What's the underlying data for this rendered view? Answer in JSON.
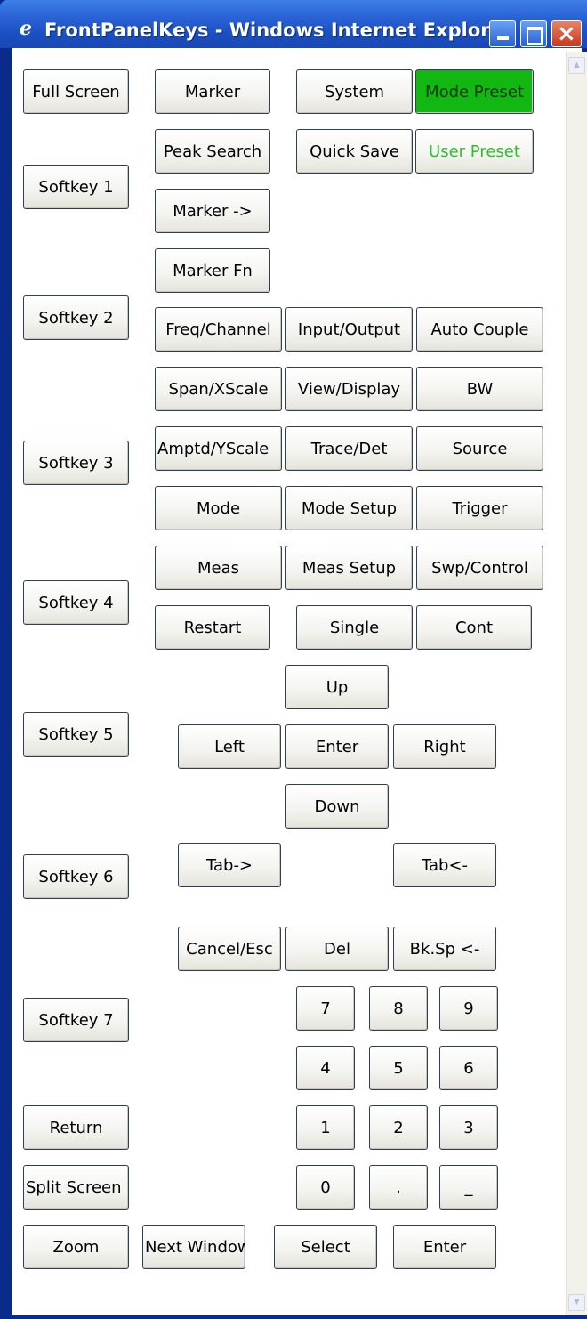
{
  "window": {
    "title": "FrontPanelKeys - Windows Internet Explorer",
    "ie_logo": "e",
    "controls": {
      "minimize": "minimize",
      "maximize": "maximize",
      "close": "×"
    },
    "title_bar_color": "#2a63d6"
  },
  "keys": {
    "full_screen": "Full Screen",
    "marker": "Marker",
    "system": "System",
    "mode_preset": "Mode Preset",
    "peak_search": "Peak Search",
    "quick_save": "Quick Save",
    "user_preset": "User Preset",
    "softkey_1": "Softkey 1",
    "marker_to": "Marker ->",
    "marker_fn": "Marker Fn",
    "softkey_2": "Softkey 2",
    "freq_channel": "Freq/Channel",
    "input_output": "Input/Output",
    "auto_couple": "Auto Couple",
    "span_xscale": "Span/XScale",
    "view_display": "View/Display",
    "bw": "BW",
    "softkey_3": "Softkey 3",
    "amptd_yscale": "Amptd/YScale",
    "trace_det": "Trace/Det",
    "source": "Source",
    "mode": "Mode",
    "mode_setup": "Mode Setup",
    "trigger": "Trigger",
    "meas": "Meas",
    "meas_setup": "Meas Setup",
    "swp_control": "Swp/Control",
    "softkey_4": "Softkey 4",
    "restart": "Restart",
    "single": "Single",
    "cont": "Cont",
    "up": "Up",
    "softkey_5": "Softkey 5",
    "left": "Left",
    "enter_nav": "Enter",
    "right": "Right",
    "down": "Down",
    "softkey_6": "Softkey 6",
    "tab_forward": "Tab->",
    "tab_back": "Tab<-",
    "cancel_esc": "Cancel/Esc",
    "del": "Del",
    "bk_sp": "Bk.Sp <-",
    "softkey_7": "Softkey 7",
    "num_7": "7",
    "num_8": "8",
    "num_9": "9",
    "num_4": "4",
    "num_5": "5",
    "num_6": "6",
    "return": "Return",
    "num_1": "1",
    "num_2": "2",
    "num_3": "3",
    "split_screen": "Split Screen",
    "num_0": "0",
    "decimal": ".",
    "underscore": "_",
    "zoom": "Zoom",
    "next_window": "Next Window",
    "select": "Select",
    "enter_main": "Enter"
  },
  "colors": {
    "mode_preset_bg": "#12b712",
    "user_preset_text": "#2fbd2f"
  }
}
